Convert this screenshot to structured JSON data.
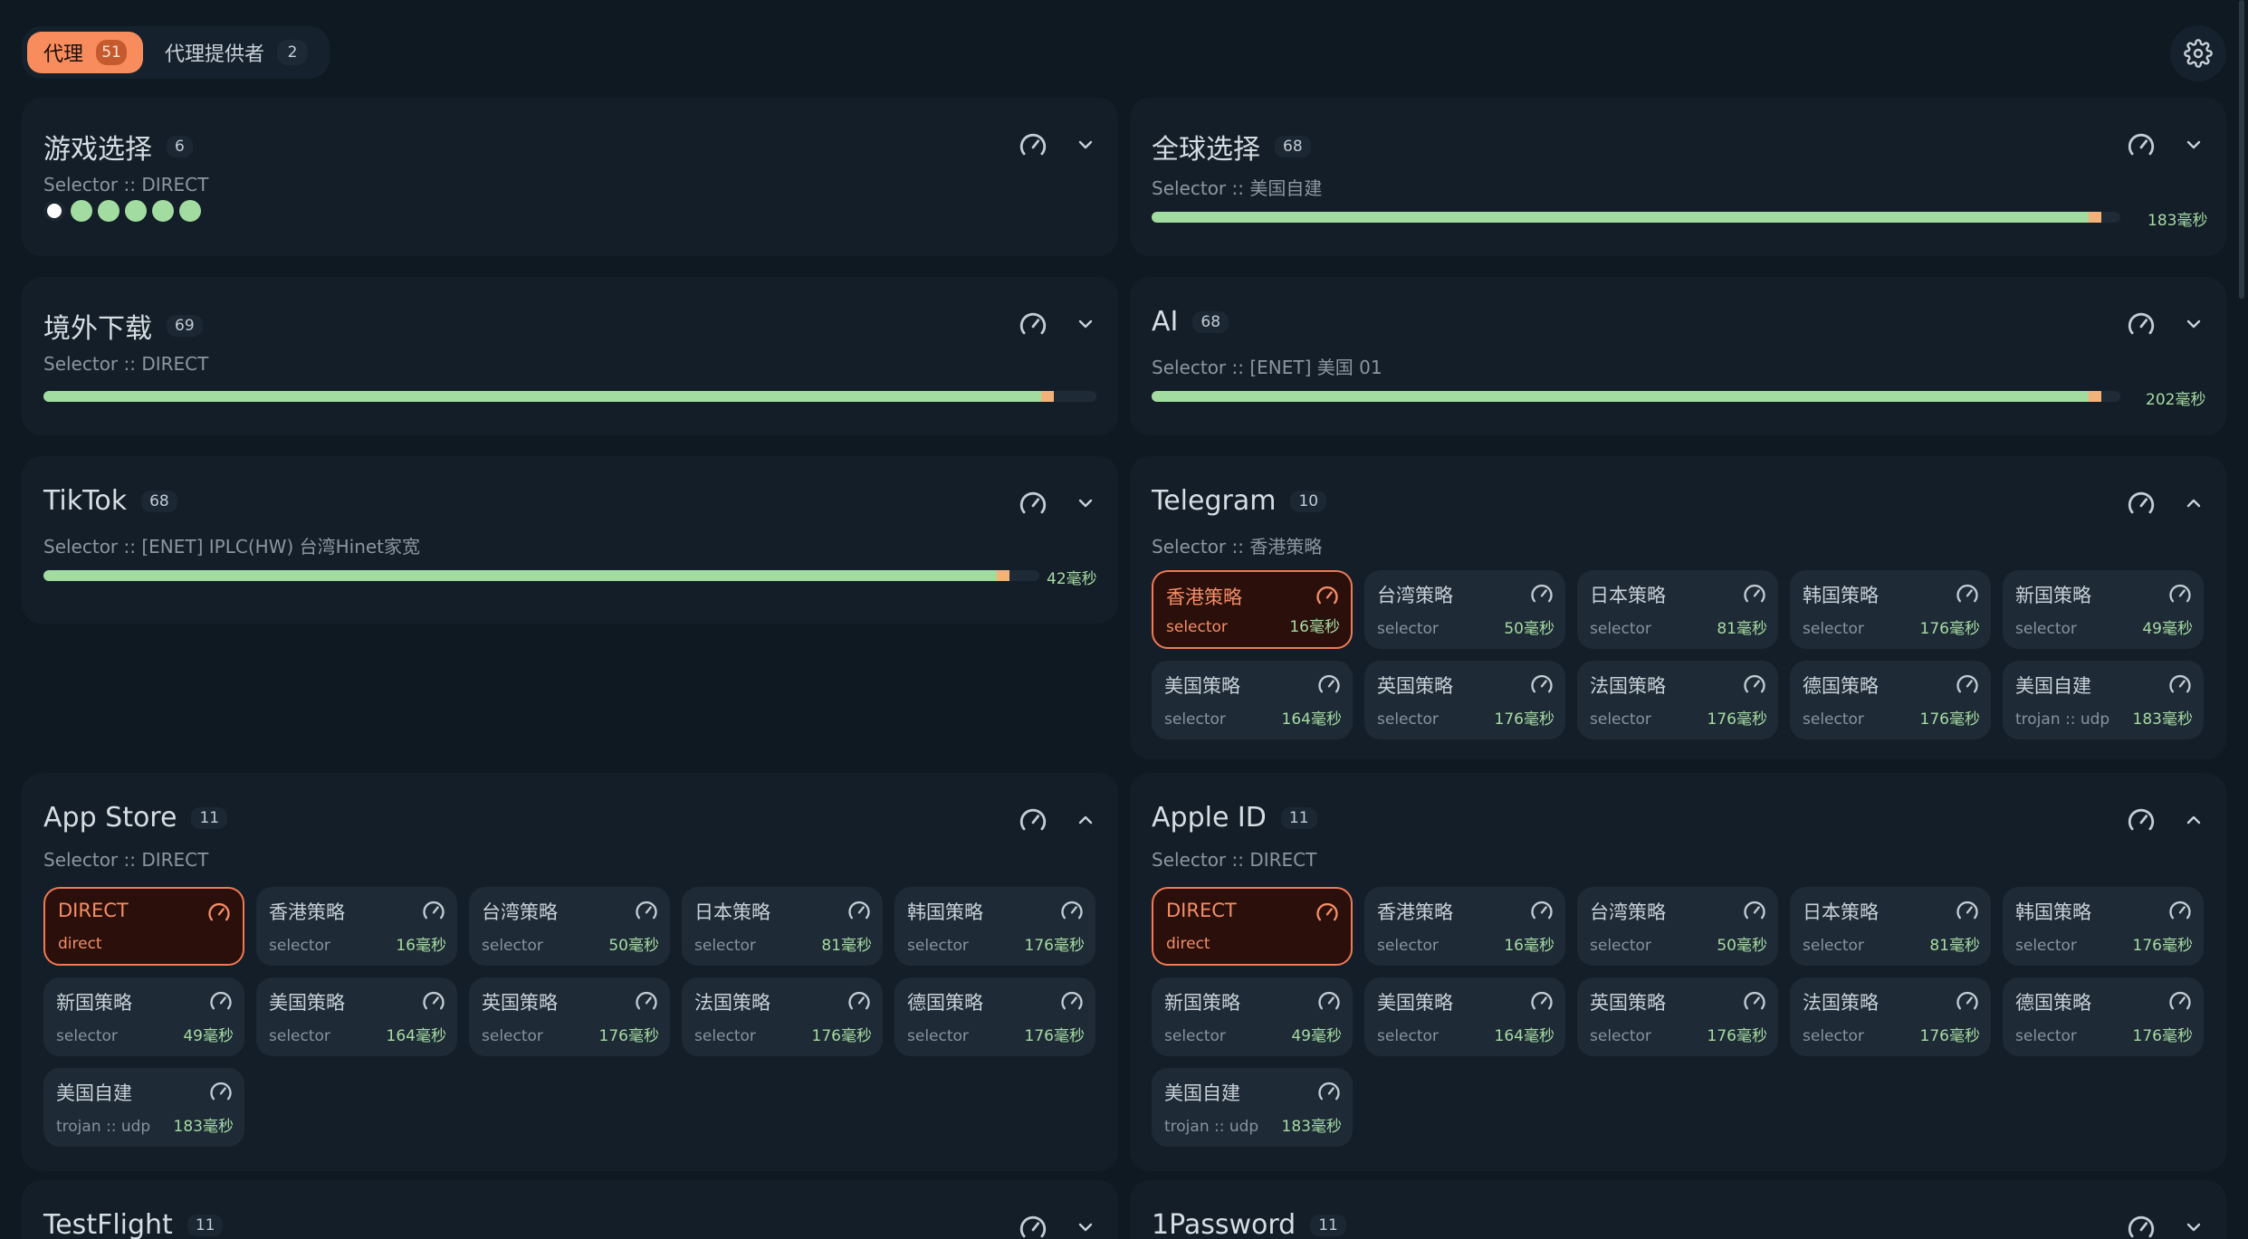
{
  "tabs": [
    {
      "label": "代理",
      "count": "51"
    },
    {
      "label": "代理提供者",
      "count": "2"
    }
  ],
  "groups": {
    "game": {
      "title": "游戏选择",
      "count": "6",
      "subtitle": "Selector :: DIRECT"
    },
    "global": {
      "title": "全球选择",
      "count": "68",
      "subtitle": "Selector :: 美国自建",
      "latency": "183毫秒",
      "fill": 0.98
    },
    "download": {
      "title": "境外下载",
      "count": "69",
      "subtitle": "Selector :: DIRECT",
      "fill": 0.96
    },
    "ai": {
      "title": "AI",
      "count": "68",
      "subtitle": "Selector :: [ENET] 美国 01",
      "latency": "202毫秒",
      "fill": 0.98
    },
    "tiktok": {
      "title": "TikTok",
      "count": "68",
      "subtitle": "Selector :: [ENET] IPLC(HW) 台湾Hinet家宽",
      "latency": "42毫秒",
      "fill": 0.97
    },
    "telegram": {
      "title": "Telegram",
      "count": "10",
      "subtitle": "Selector :: 香港策略"
    },
    "appstore": {
      "title": "App Store",
      "count": "11",
      "subtitle": "Selector :: DIRECT"
    },
    "appleid": {
      "title": "Apple ID",
      "count": "11",
      "subtitle": "Selector :: DIRECT"
    },
    "testflight": {
      "title": "TestFlight",
      "count": "11"
    },
    "onepassword": {
      "title": "1Password",
      "count": "11"
    }
  },
  "telegram_nodes": [
    {
      "name": "香港策略",
      "type": "selector",
      "latency": "16毫秒"
    },
    {
      "name": "台湾策略",
      "type": "selector",
      "latency": "50毫秒"
    },
    {
      "name": "日本策略",
      "type": "selector",
      "latency": "81毫秒"
    },
    {
      "name": "韩国策略",
      "type": "selector",
      "latency": "176毫秒"
    },
    {
      "name": "新国策略",
      "type": "selector",
      "latency": "49毫秒"
    },
    {
      "name": "美国策略",
      "type": "selector",
      "latency": "164毫秒"
    },
    {
      "name": "英国策略",
      "type": "selector",
      "latency": "176毫秒"
    },
    {
      "name": "法国策略",
      "type": "selector",
      "latency": "176毫秒"
    },
    {
      "name": "德国策略",
      "type": "selector",
      "latency": "176毫秒"
    },
    {
      "name": "美国自建",
      "type": "trojan :: udp",
      "latency": "183毫秒"
    }
  ],
  "direct_nodes": [
    {
      "name": "DIRECT",
      "type": "direct",
      "latency": ""
    },
    {
      "name": "香港策略",
      "type": "selector",
      "latency": "16毫秒"
    },
    {
      "name": "台湾策略",
      "type": "selector",
      "latency": "50毫秒"
    },
    {
      "name": "日本策略",
      "type": "selector",
      "latency": "81毫秒"
    },
    {
      "name": "韩国策略",
      "type": "selector",
      "latency": "176毫秒"
    },
    {
      "name": "新国策略",
      "type": "selector",
      "latency": "49毫秒"
    },
    {
      "name": "美国策略",
      "type": "selector",
      "latency": "164毫秒"
    },
    {
      "name": "英国策略",
      "type": "selector",
      "latency": "176毫秒"
    },
    {
      "name": "法国策略",
      "type": "selector",
      "latency": "176毫秒"
    },
    {
      "name": "德国策略",
      "type": "selector",
      "latency": "176毫秒"
    },
    {
      "name": "美国自建",
      "type": "trojan :: udp",
      "latency": "183毫秒"
    }
  ],
  "colors": {
    "accent": "#f98c5c",
    "latency_good": "#a7dba2",
    "bar_fill": "#a3dca0"
  }
}
